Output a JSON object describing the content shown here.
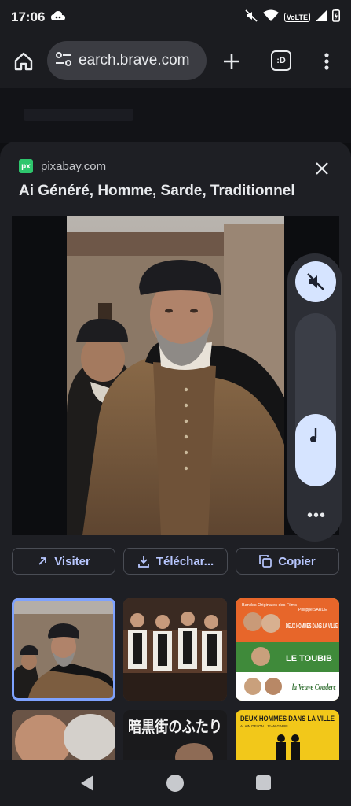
{
  "status": {
    "time": "17:06",
    "network_label": "VoLTE"
  },
  "toolbar": {
    "url": "earch.brave.com",
    "tabs_label": ":D"
  },
  "panel": {
    "source": "pixabay.com",
    "source_badge": "px",
    "title": "Ai Généré, Homme, Sarde, Traditionnel"
  },
  "volume": {
    "level": 0.42,
    "more_label": "•••"
  },
  "actions": [
    {
      "label": "Visiter"
    },
    {
      "label": "Téléchar..."
    },
    {
      "label": "Copier"
    }
  ],
  "thumbnails": {
    "poster1": {
      "top": "Bandes Originales des Films",
      "composer": "Philippe SARDE",
      "film1": "DEUX HOMMES DANS LA VILLE",
      "film2": "LE TOUBIB",
      "film3": "la Veuve Couderc"
    },
    "poster2": {
      "jp_title": "暗黒街のふたり"
    },
    "poster3": {
      "title": "DEUX HOMMES DANS LA VILLE",
      "credit": "ALAIN DELON · JEAN GABIN"
    }
  },
  "colors": {
    "accent": "#b8c7ff",
    "selection": "#7ea2ff",
    "sheet": "#1e1f24",
    "volume_fill": "#d6e4ff"
  }
}
